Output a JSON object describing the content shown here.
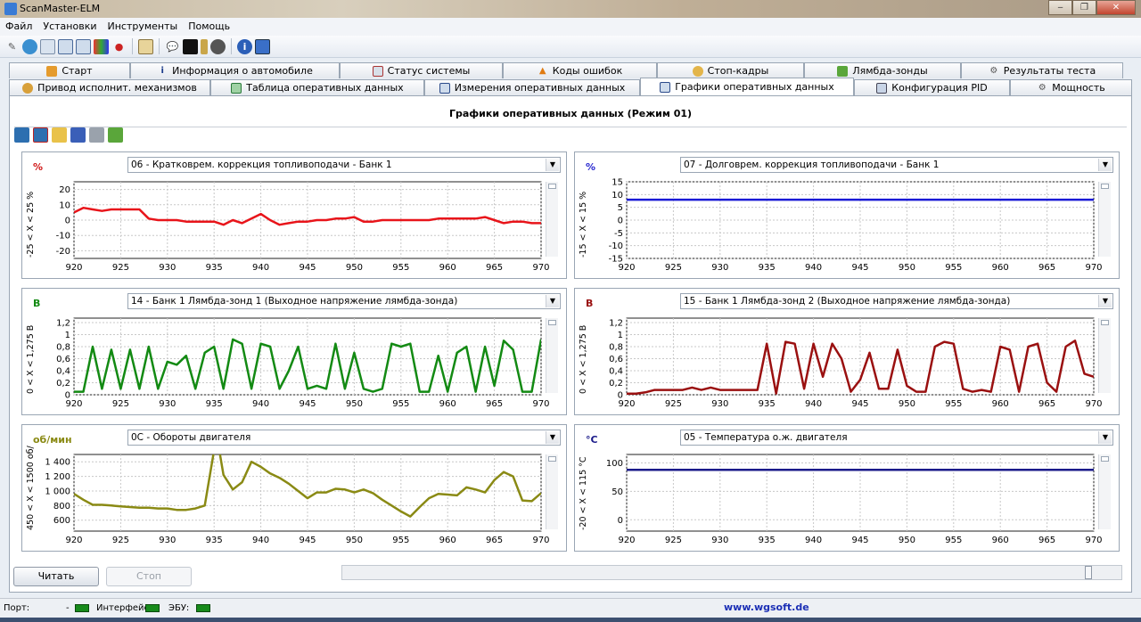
{
  "window": {
    "title": "ScanMaster-ELM",
    "min": "‒",
    "max": "❐",
    "close": "✕"
  },
  "menu": [
    "Файл",
    "Установки",
    "Инструменты",
    "Помощь"
  ],
  "tabs_row1": [
    {
      "label": "Старт",
      "icon": "home-icon"
    },
    {
      "label": "Информация о автомобиле",
      "icon": "info-icon"
    },
    {
      "label": "Статус системы",
      "icon": "status-icon"
    },
    {
      "label": "Коды ошибок",
      "icon": "warning-icon"
    },
    {
      "label": "Стоп-кадры",
      "icon": "freeze-frame-icon"
    },
    {
      "label": "Лямбда-зонды",
      "icon": "lambda-icon"
    },
    {
      "label": "Результаты теста",
      "icon": "gear-icon"
    }
  ],
  "tabs_row2": [
    {
      "label": "Привод исполнит. механизмов",
      "icon": "actuator-icon"
    },
    {
      "label": "Таблица оперативных данных",
      "icon": "table-icon"
    },
    {
      "label": "Измерения оперативных данных",
      "icon": "gauge-icon"
    },
    {
      "label": "Графики оперативных данных",
      "icon": "chart-icon",
      "active": true
    },
    {
      "label": "Конфигурация PID",
      "icon": "config-icon"
    },
    {
      "label": "Мощность",
      "icon": "power-icon"
    }
  ],
  "panel_title": "Графики оперативных данных (Режим 01)",
  "charts": [
    {
      "unit": "%",
      "pid": "06 - Кратковрем. коррекция топливоподачи - Банк 1",
      "ylabel": "-25  < X <  25  %"
    },
    {
      "unit": "%",
      "pid": "07 - Долговрем. коррекция топливоподачи - Банк 1",
      "ylabel": "-15  < X <  15  %"
    },
    {
      "unit": "В",
      "pid": "14 - Банк 1 Лямбда-зонд 1 (Выходное напряжение лямбда-зонда)",
      "ylabel": "0  < X <  1,275  В"
    },
    {
      "unit": "В",
      "pid": "15 - Банк 1 Лямбда-зонд 2 (Выходное напряжение лямбда-зонда)",
      "ylabel": "0  < X <  1,275  В"
    },
    {
      "unit": "об/мин",
      "pid": "0C - Обороты двигателя",
      "ylabel": "450  < X <  1500  об/"
    },
    {
      "unit": "°C",
      "pid": "05 - Температура о.ж. двигателя",
      "ylabel": "-20  < X <  115  °C"
    }
  ],
  "chart_data": [
    {
      "type": "line",
      "color": "#e8141a",
      "x": [
        920,
        921,
        922,
        923,
        924,
        925,
        926,
        927,
        928,
        929,
        930,
        931,
        932,
        933,
        934,
        935,
        936,
        937,
        938,
        939,
        940,
        941,
        942,
        943,
        944,
        945,
        946,
        947,
        948,
        949,
        950,
        951,
        952,
        953,
        954,
        955,
        956,
        957,
        958,
        959,
        960,
        961,
        962,
        963,
        964,
        965,
        966,
        967,
        968,
        969,
        970
      ],
      "y": [
        5,
        8,
        7,
        6,
        7,
        7,
        7,
        7,
        1,
        0,
        0,
        0,
        -1,
        -1,
        -1,
        -1,
        -3,
        0,
        -2,
        1,
        4,
        0,
        -3,
        -2,
        -1,
        -1,
        0,
        0,
        1,
        1,
        2,
        -1,
        -1,
        0,
        0,
        0,
        0,
        0,
        0,
        1,
        1,
        1,
        1,
        1,
        2,
        0,
        -2,
        -1,
        -1,
        -2,
        -2
      ],
      "ylim": [
        -25,
        25
      ],
      "ticks": [
        20,
        10,
        0,
        -10,
        -20
      ],
      "xticks": [
        920,
        925,
        930,
        935,
        940,
        945,
        950,
        955,
        960,
        965,
        970
      ]
    },
    {
      "type": "line",
      "color": "#1a1ad6",
      "x": [
        920,
        970
      ],
      "y": [
        8,
        8
      ],
      "ylim": [
        -15,
        15
      ],
      "ticks": [
        15,
        10,
        5,
        0,
        -5,
        -10,
        -15
      ],
      "xticks": [
        920,
        925,
        930,
        935,
        940,
        945,
        950,
        955,
        960,
        965,
        970
      ]
    },
    {
      "type": "line",
      "color": "#138a13",
      "x": [
        920,
        921,
        922,
        923,
        924,
        925,
        926,
        927,
        928,
        929,
        930,
        931,
        932,
        933,
        934,
        935,
        936,
        937,
        938,
        939,
        940,
        941,
        942,
        943,
        944,
        945,
        946,
        947,
        948,
        949,
        950,
        951,
        952,
        953,
        954,
        955,
        956,
        957,
        958,
        959,
        960,
        961,
        962,
        963,
        964,
        965,
        966,
        967,
        968,
        969,
        970
      ],
      "y": [
        0.05,
        0.05,
        0.8,
        0.1,
        0.75,
        0.1,
        0.75,
        0.1,
        0.8,
        0.1,
        0.55,
        0.5,
        0.65,
        0.1,
        0.7,
        0.8,
        0.1,
        0.92,
        0.85,
        0.1,
        0.85,
        0.8,
        0.1,
        0.4,
        0.8,
        0.1,
        0.15,
        0.1,
        0.85,
        0.1,
        0.7,
        0.1,
        0.05,
        0.1,
        0.85,
        0.8,
        0.85,
        0.05,
        0.05,
        0.65,
        0.05,
        0.7,
        0.8,
        0.05,
        0.8,
        0.15,
        0.9,
        0.75,
        0.05,
        0.05,
        0.92
      ],
      "ylim": [
        0,
        1.275
      ],
      "ticks": [
        "1,2",
        "1",
        "0,8",
        "0,6",
        "0,4",
        "0,2",
        "0"
      ],
      "tickvals": [
        1.2,
        1,
        0.8,
        0.6,
        0.4,
        0.2,
        0
      ],
      "xticks": [
        920,
        925,
        930,
        935,
        940,
        945,
        950,
        955,
        960,
        965,
        970
      ]
    },
    {
      "type": "line",
      "color": "#9a1010",
      "x": [
        920,
        921,
        922,
        923,
        924,
        925,
        926,
        927,
        928,
        929,
        930,
        931,
        932,
        933,
        934,
        935,
        936,
        937,
        938,
        939,
        940,
        941,
        942,
        943,
        944,
        945,
        946,
        947,
        948,
        949,
        950,
        951,
        952,
        953,
        954,
        955,
        956,
        957,
        958,
        959,
        960,
        961,
        962,
        963,
        964,
        965,
        966,
        967,
        968,
        969,
        970
      ],
      "y": [
        0.02,
        0.02,
        0.04,
        0.08,
        0.08,
        0.08,
        0.08,
        0.12,
        0.08,
        0.12,
        0.08,
        0.08,
        0.08,
        0.08,
        0.08,
        0.85,
        0.02,
        0.88,
        0.85,
        0.1,
        0.85,
        0.3,
        0.85,
        0.6,
        0.05,
        0.25,
        0.7,
        0.1,
        0.1,
        0.75,
        0.15,
        0.05,
        0.05,
        0.8,
        0.88,
        0.85,
        0.1,
        0.05,
        0.08,
        0.05,
        0.8,
        0.75,
        0.05,
        0.8,
        0.85,
        0.2,
        0.05,
        0.8,
        0.9,
        0.35,
        0.3
      ],
      "ylim": [
        0,
        1.275
      ],
      "ticks": [
        "1,2",
        "1",
        "0,8",
        "0,6",
        "0,4",
        "0,2",
        "0"
      ],
      "tickvals": [
        1.2,
        1,
        0.8,
        0.6,
        0.4,
        0.2,
        0
      ],
      "xticks": [
        920,
        925,
        930,
        935,
        940,
        945,
        950,
        955,
        960,
        965,
        970
      ]
    },
    {
      "type": "line",
      "color": "#8a8a14",
      "x": [
        920,
        921,
        922,
        923,
        924,
        925,
        926,
        927,
        928,
        929,
        930,
        931,
        932,
        933,
        934,
        935,
        935.5,
        936,
        937,
        938,
        939,
        940,
        941,
        942,
        943,
        944,
        945,
        946,
        947,
        948,
        949,
        950,
        951,
        952,
        953,
        954,
        955,
        956,
        957,
        958,
        959,
        960,
        961,
        962,
        963,
        964,
        965,
        966,
        967,
        968,
        969,
        970
      ],
      "y": [
        960,
        880,
        810,
        810,
        800,
        790,
        780,
        770,
        770,
        760,
        760,
        740,
        740,
        760,
        800,
        1560,
        1600,
        1220,
        1020,
        1120,
        1400,
        1330,
        1240,
        1180,
        1100,
        1000,
        900,
        980,
        980,
        1030,
        1020,
        980,
        1020,
        970,
        880,
        800,
        720,
        650,
        780,
        900,
        960,
        950,
        940,
        1050,
        1020,
        980,
        1150,
        1260,
        1200,
        870,
        860,
        970
      ],
      "ylim": [
        450,
        1500
      ],
      "ticks": [
        "1 400",
        "1 200",
        "1 000",
        "800",
        "600"
      ],
      "tickvals": [
        1400,
        1200,
        1000,
        800,
        600
      ],
      "xticks": [
        920,
        925,
        930,
        935,
        940,
        945,
        950,
        955,
        960,
        965,
        970
      ]
    },
    {
      "type": "line",
      "color": "#1a1a8a",
      "x": [
        920,
        970
      ],
      "y": [
        88,
        88
      ],
      "ylim": [
        -20,
        115
      ],
      "ticks": [
        100,
        50,
        0
      ],
      "xticks": [
        920,
        925,
        930,
        935,
        940,
        945,
        950,
        955,
        960,
        965,
        970
      ]
    }
  ],
  "buttons": {
    "read": "Читать",
    "stop": "Стоп"
  },
  "status": {
    "port": "Порт:",
    "port_val": "-",
    "iface": "Интерфейс:",
    "ecu": "ЭБУ:",
    "url": "www.wgsoft.de"
  }
}
